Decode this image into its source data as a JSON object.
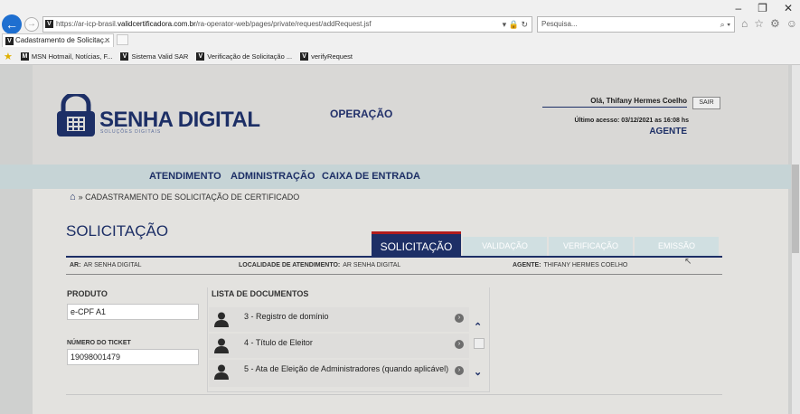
{
  "browser": {
    "window_controls": [
      "–",
      "❐",
      "✕"
    ],
    "address_prefix": "https://ar-icp-brasil.",
    "address_domain": "validcertificadora.com.br",
    "address_suffix": "/ra-operator-web/pages/private/request/addRequest.jsf",
    "search_placeholder": "Pesquisa...",
    "tab_title": "Cadastramento de Solicitaç...",
    "favorites": [
      {
        "label": "MSN  Hotmail, Notícias, F..."
      },
      {
        "label": "Sistema Valid SAR"
      },
      {
        "label": "Verificação de Solicitação ..."
      },
      {
        "label": "verifyRequest"
      }
    ]
  },
  "header": {
    "brand": "SENHA DIGITAL",
    "brand_sub": "SOLUÇÕES DIGITAIS",
    "section": "OPERAÇÃO",
    "greeting": "Olá, Thifany Hermes Coelho",
    "logout": "SAIR",
    "last_access": "Último acesso: 03/12/2021 as 16:08 hs",
    "role": "AGENTE"
  },
  "nav": {
    "items": [
      "ATENDIMENTO",
      "ADMINISTRAÇÃO",
      "CAIXA DE ENTRADA"
    ]
  },
  "breadcrumb": "» CADASTRAMENTO DE SOLICITAÇÃO DE CERTIFICADO",
  "page_title": "SOLICITAÇÃO",
  "steps": [
    "SOLICITAÇÃO",
    "VALIDAÇÃO",
    "VERIFICAÇÃO",
    "EMISSÃO"
  ],
  "info": {
    "ar_label": "AR:",
    "ar_value": "AR SENHA DIGITAL",
    "loc_label": "LOCALIDADE DE ATENDIMENTO:",
    "loc_value": "AR SENHA DIGITAL",
    "agent_label": "AGENTE:",
    "agent_value": "THIFANY HERMES COELHO"
  },
  "form": {
    "product_label": "PRODUTO",
    "product_value": "e-CPF A1",
    "ticket_label": "NÚMERO DO TICKET",
    "ticket_value": "19098001479"
  },
  "documents": {
    "title": "LISTA DE DOCUMENTOS",
    "items": [
      {
        "name": "3 - Registro de domínio"
      },
      {
        "name": "4 - Título de Eleitor"
      },
      {
        "name": "5 - Ata de Eleição de Administradores (quando aplicável)"
      }
    ]
  }
}
